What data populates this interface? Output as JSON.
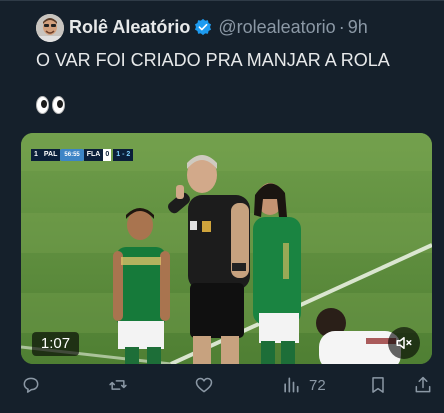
{
  "post": {
    "author_name": "Rolê Aleatório",
    "handle": "@rolealeatorio",
    "separator": "·",
    "time": "9h",
    "text": "O VAR FOI CRIADO PRA MANJAR A ROLA",
    "emoji_icon": "eyes-emoji",
    "verified_color": "#1d9bf0"
  },
  "media": {
    "duration": "1:07",
    "scorebug": {
      "home_score_label": "1",
      "home_team": "PAL",
      "clock": "56:55",
      "away_team": "FLA",
      "away_score": "0",
      "aggregate": "1 - 2"
    },
    "mute_icon": "volume-mute-icon"
  },
  "actions": {
    "views_count": "72",
    "icons": [
      "reply-icon",
      "retweet-icon",
      "like-icon",
      "views-icon",
      "bookmark-icon",
      "share-icon"
    ]
  }
}
